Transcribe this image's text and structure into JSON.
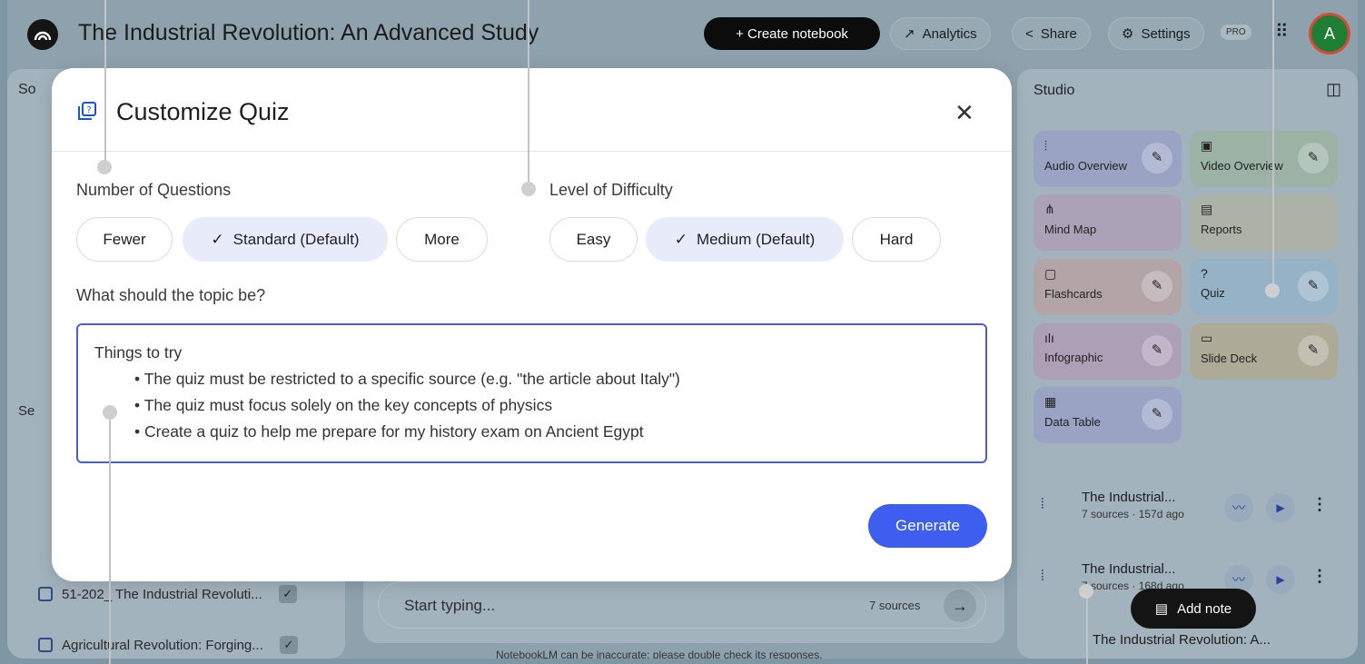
{
  "topbar": {
    "notebook_title": "The Industrial Revolution: An Advanced Study",
    "create_label": "+ Create notebook",
    "analytics_label": "Analytics",
    "share_label": "Share",
    "settings_label": "Settings",
    "pro_badge": "PRO",
    "avatar_letter": "A"
  },
  "sources": {
    "header": "So",
    "section_label": "Se",
    "items": [
      {
        "label": "51-202_ The Industrial Revoluti..."
      },
      {
        "label": "Agricultural Revolution: Forging..."
      }
    ]
  },
  "chat": {
    "placeholder": "Start typing...",
    "source_count": "7 sources",
    "footer_note": "NotebookLM can be inaccurate; please double check its responses."
  },
  "studio": {
    "header": "Studio",
    "tiles": [
      {
        "label": "Audio Overview",
        "icon": "audio-icon"
      },
      {
        "label": "Video Overview",
        "icon": "video-icon"
      },
      {
        "label": "Mind Map",
        "icon": "mindmap-icon"
      },
      {
        "label": "Reports",
        "icon": "reports-icon"
      },
      {
        "label": "Flashcards",
        "icon": "flashcards-icon"
      },
      {
        "label": "Quiz",
        "icon": "quiz-icon"
      },
      {
        "label": "Infographic",
        "icon": "infographic-icon"
      },
      {
        "label": "Slide Deck",
        "icon": "slide-deck-icon"
      },
      {
        "label": "Data Table",
        "icon": "data-table-icon"
      }
    ],
    "generated": [
      {
        "title": "The Industrial...",
        "meta": "7 sources · 157d ago"
      },
      {
        "title": "The Industrial...",
        "meta": "7 sources · 168d ago"
      },
      {
        "title": "The Industrial Revolution: A...",
        "meta": ""
      }
    ],
    "add_note_label": "Add note"
  },
  "dialog": {
    "title": "Customize Quiz",
    "questions_label": "Number of Questions",
    "questions_options": [
      "Fewer",
      "Standard (Default)",
      "More"
    ],
    "questions_selected": "Standard (Default)",
    "difficulty_label": "Level of Difficulty",
    "difficulty_options": [
      "Easy",
      "Medium (Default)",
      "Hard"
    ],
    "difficulty_selected": "Medium (Default)",
    "topic_label": "What should the topic be?",
    "topic_placeholder_heading": "Things to try",
    "topic_tips": [
      "The quiz must be restricted to a specific source (e.g. \"the article about Italy\")",
      "The quiz must focus solely on the key concepts of physics",
      "Create a quiz to help me prepare for my history exam on Ancient Egypt"
    ],
    "generate_label": "Generate"
  },
  "colors": {
    "accent": "#3e5ef0",
    "selected_chip": "#e8ecfa",
    "overlay": "#8ea2ae"
  }
}
